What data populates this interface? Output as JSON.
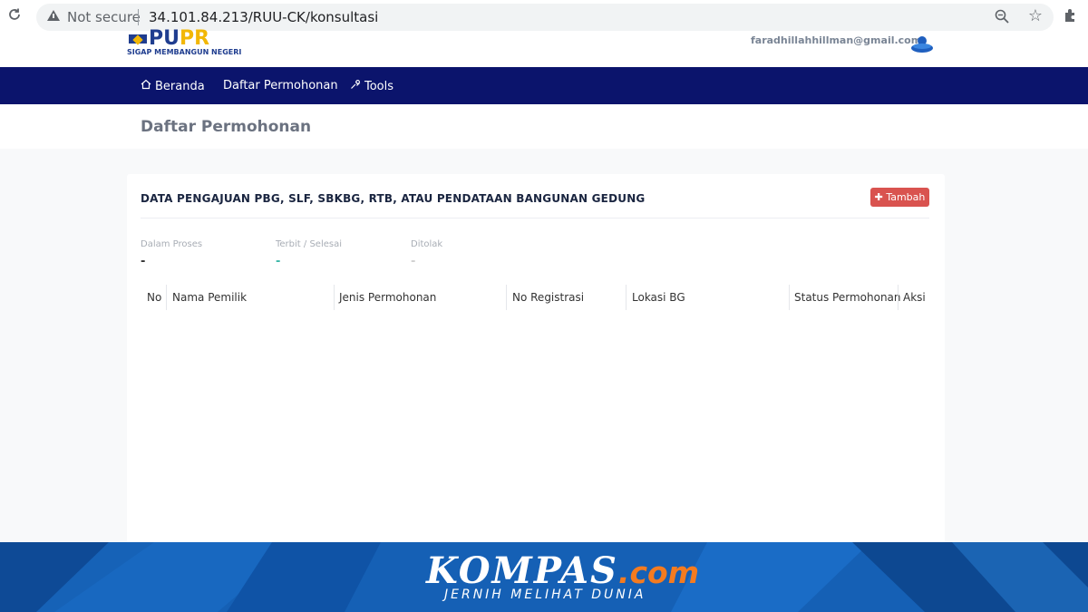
{
  "browser": {
    "security_label": "Not secure",
    "url": "34.101.84.213/RUU-CK/konsultasi"
  },
  "header": {
    "logo_pu": "PU",
    "logo_pr": "PR",
    "logo_tagline": "SIGAP MEMBANGUN NEGERI",
    "user_email": "faradhillahhillman@gmail.com"
  },
  "nav": {
    "items": [
      {
        "label": "Beranda",
        "icon": "home-icon"
      },
      {
        "label": "Daftar Permohonan",
        "icon": ""
      },
      {
        "label": "Tools",
        "icon": "wrench-icon"
      }
    ]
  },
  "page": {
    "title": "Daftar Permohonan"
  },
  "card": {
    "title": "DATA PENGAJUAN PBG, SLF, SBKBG, RTB, ATAU PENDATAAN BANGUNAN GEDUNG",
    "add_button": "Tambah",
    "add_color": "#d9534f",
    "stats": [
      {
        "label": "Dalam Proses",
        "value": "-",
        "color": "#333333"
      },
      {
        "label": "Terbit / Selesai",
        "value": "-",
        "color": "#3cb7a9"
      },
      {
        "label": "Ditolak",
        "value": "-",
        "color": "#d9d9d9"
      }
    ],
    "table_headers": [
      "No",
      "Nama Pemilik",
      "Jenis Permohonan",
      "No Registrasi",
      "Lokasi BG",
      "Status Permohonan",
      "Aksi"
    ]
  },
  "watermark": {
    "brand": "KOMPAS",
    "domain": ".com",
    "tagline": "JERNIH MELIHAT DUNIA"
  },
  "colors": {
    "nav_bg": "#0b146c",
    "footer_bg": "#1560b5",
    "accent_orange": "#f47b20"
  }
}
